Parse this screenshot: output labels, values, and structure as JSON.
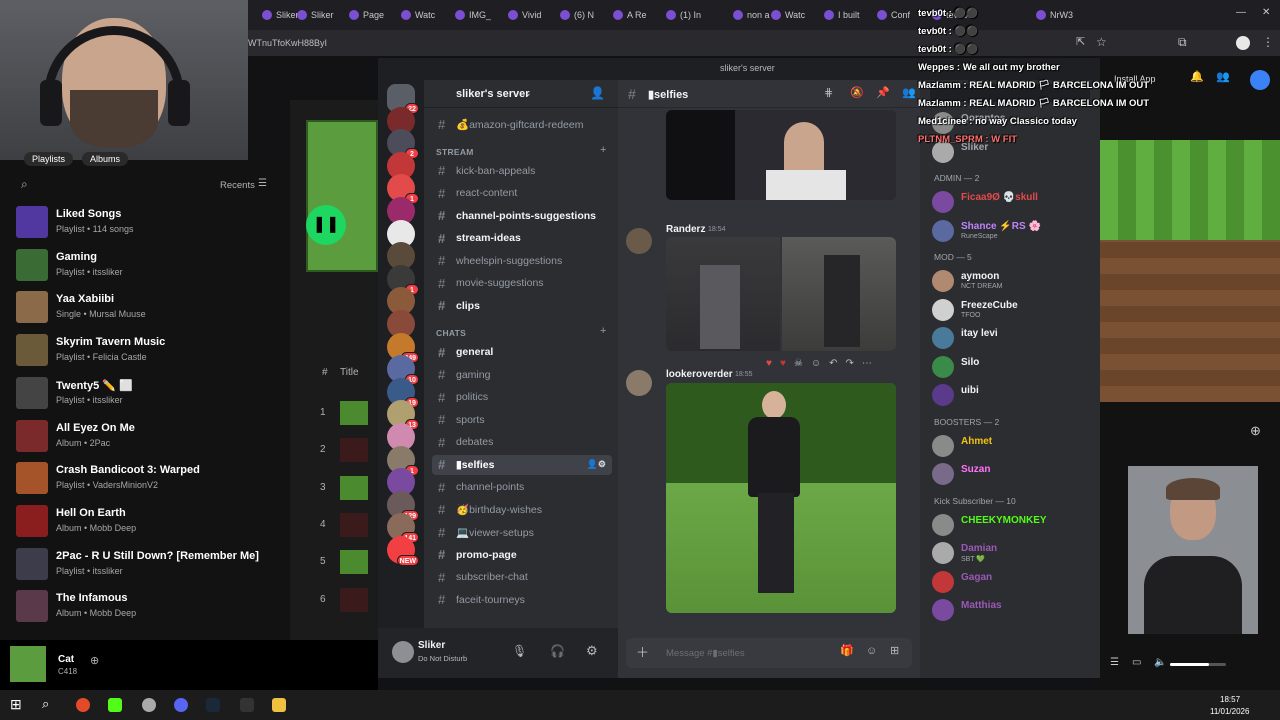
{
  "browser": {
    "tabs": [
      "Sliker",
      "Sliker",
      "Page",
      "Watc",
      "IMG_",
      "Vivid",
      "(6) N",
      "A Re",
      "(1) In",
      "non a",
      "Watc",
      "I built",
      "Conf",
      "tevb0t",
      "NrW3"
    ],
    "address": "WTnuTfoKwH88ByI",
    "window_title": "sliker's server"
  },
  "spotify": {
    "tabs": [
      "Playlists",
      "Albums"
    ],
    "recents_label": "Recents",
    "items": [
      {
        "title": "Liked Songs",
        "sub": "Playlist • 114 songs",
        "color": "#5038a0"
      },
      {
        "title": "Gaming",
        "sub": "Playlist • itssliker",
        "color": "#3a6b35"
      },
      {
        "title": "Yaa Xabiibi",
        "sub": "Single • Mursal Muuse",
        "color": "#8b6a4a"
      },
      {
        "title": "Skyrim Tavern Music",
        "sub": "Playlist • Felicia Castle",
        "color": "#6b5a3a"
      },
      {
        "title": "Twenty5 ✏️ ⬜",
        "sub": "Playlist • itssliker",
        "color": "#444"
      },
      {
        "title": "All Eyez On Me",
        "sub": "Album • 2Pac",
        "color": "#7a2a2a"
      },
      {
        "title": "Crash Bandicoot 3: Warped",
        "sub": "Playlist • VadersMinionV2",
        "color": "#a5542a"
      },
      {
        "title": "Hell On Earth",
        "sub": "Album • Mobb Deep",
        "color": "#8a1e1e"
      },
      {
        "title": "2Pac - R U Still Down? [Remember Me]",
        "sub": "Playlist • itssliker",
        "color": "#3c3c4a"
      },
      {
        "title": "The Infamous",
        "sub": "Album • Mobb Deep",
        "color": "#5a3a4a"
      }
    ],
    "track_header": {
      "num": "#",
      "title": "Title"
    },
    "track_numbers": [
      "1",
      "2",
      "3",
      "4",
      "5",
      "6"
    ],
    "now_playing": {
      "title": "Cat",
      "sub": "C418"
    }
  },
  "discord": {
    "server_name": "sliker's server",
    "channel_header": "▮selfies",
    "channels": [
      {
        "name": "💰amazon-giftcard-redeem",
        "bold": false,
        "active": false
      },
      {
        "type": "category",
        "name": "STREAM"
      },
      {
        "name": "kick-ban-appeals",
        "bold": false,
        "active": false
      },
      {
        "name": "react-content",
        "bold": false,
        "active": false
      },
      {
        "name": "channel-points-suggestions",
        "bold": true,
        "active": false
      },
      {
        "name": "stream-ideas",
        "bold": true,
        "active": false
      },
      {
        "name": "wheelspin-suggestions",
        "bold": false,
        "active": false
      },
      {
        "name": "movie-suggestions",
        "bold": false,
        "active": false
      },
      {
        "name": "clips",
        "bold": true,
        "active": false
      },
      {
        "type": "category",
        "name": "CHATS"
      },
      {
        "name": "general",
        "bold": true,
        "active": false
      },
      {
        "name": "gaming",
        "bold": false,
        "active": false
      },
      {
        "name": "politics",
        "bold": false,
        "active": false
      },
      {
        "name": "sports",
        "bold": false,
        "active": false
      },
      {
        "name": "debates",
        "bold": false,
        "active": false
      },
      {
        "name": "▮selfies",
        "bold": true,
        "active": true
      },
      {
        "name": "channel-points",
        "bold": false,
        "active": false
      },
      {
        "name": "🥳birthday-wishes",
        "bold": false,
        "active": false
      },
      {
        "name": "💻viewer-setups",
        "bold": false,
        "active": false
      },
      {
        "name": "promo-page",
        "bold": true,
        "active": false
      },
      {
        "name": "subscriber-chat",
        "bold": false,
        "active": false
      },
      {
        "name": "faceit-tourneys",
        "bold": false,
        "active": false
      }
    ],
    "server_badges": [
      "22",
      "",
      "2",
      "",
      "1",
      "",
      "",
      "",
      "1",
      "",
      "",
      "449",
      "10",
      "19",
      "13",
      "",
      "1",
      "",
      "129",
      "141",
      "NEW"
    ],
    "messages": [
      {
        "author": "Randerz",
        "time": "18:54"
      },
      {
        "author": "lookeroverder",
        "time": "18:55"
      }
    ],
    "composer_placeholder": "Message #▮selfies",
    "user": {
      "name": "Sliker",
      "status": "Do Not Disturb"
    },
    "members": [
      {
        "type": "member",
        "name": "Qorantos",
        "status": "",
        "color": "#a1a6ad"
      },
      {
        "type": "member",
        "name": "Sliker",
        "status": "",
        "color": "#a1a6ad"
      },
      {
        "type": "category",
        "name": "ADMIN — 2"
      },
      {
        "type": "member",
        "name": "Ficaa9Ø  💀skull",
        "status": "",
        "color": "#e34a4a"
      },
      {
        "type": "member",
        "name": "Shance ⚡RS 🌸",
        "status": "RuneScape",
        "color": "#c084fc"
      },
      {
        "type": "category",
        "name": "MOD — 5"
      },
      {
        "type": "member",
        "name": "aymoon",
        "status": "NCT DREAM",
        "color": "#f2f3f5"
      },
      {
        "type": "member",
        "name": "FreezeCube",
        "status": "TFOO",
        "color": "#f2f3f5"
      },
      {
        "type": "member",
        "name": "itay levi",
        "status": "",
        "color": "#f2f3f5"
      },
      {
        "type": "member",
        "name": "Silo",
        "status": "",
        "color": "#f2f3f5"
      },
      {
        "type": "member",
        "name": "uibi",
        "status": "",
        "color": "#f2f3f5"
      },
      {
        "type": "category",
        "name": "BOOSTERS — 2"
      },
      {
        "type": "member",
        "name": "Ahmet",
        "status": "",
        "color": "#f1c40f"
      },
      {
        "type": "member",
        "name": "Suzan",
        "status": "",
        "color": "#ff73fa"
      },
      {
        "type": "category",
        "name": "Kick Subscriber — 10"
      },
      {
        "type": "member",
        "name": "CHEEKYMONKEY",
        "status": "",
        "color": "#53fc18"
      },
      {
        "type": "member",
        "name": "Damian",
        "status": "SBT 💚",
        "color": "#9b59b6"
      },
      {
        "type": "member",
        "name": "Gagan",
        "status": "",
        "color": "#9b59b6"
      },
      {
        "type": "member",
        "name": "Matthias",
        "status": "",
        "color": "#9b59b6"
      }
    ]
  },
  "chat_overlay": [
    {
      "text": "tevb0t : ⚫⚫",
      "color": "#ffffff"
    },
    {
      "text": "tevb0t : ⚫⚫",
      "color": "#ffffff"
    },
    {
      "text": "tevb0t : ⚫⚫",
      "color": "#ffffff"
    },
    {
      "text": "Weppes : We all out my brother",
      "color": "#ffffff"
    },
    {
      "text": "Mazlamm : REAL MADRID 🏳 BARCELONA IM OUT",
      "color": "#ffffff"
    },
    {
      "text": "Mazlamm : REAL MADRID 🏳 BARCELONA IM OUT",
      "color": "#ffffff"
    },
    {
      "text": "Med1cinee : no way Classico today",
      "color": "#ffffff"
    },
    {
      "text": "PLTNM_SPRM : W FIT",
      "color": "#ff6f6f"
    }
  ],
  "install_app": "Install App",
  "taskbar": {
    "time": "18:57",
    "date": "11/01/2026"
  },
  "colors": {
    "discord_bg": "#313338",
    "discord_sidebar": "#2b2d31",
    "spotify_green": "#1ed760",
    "accent": "#5865f2"
  }
}
